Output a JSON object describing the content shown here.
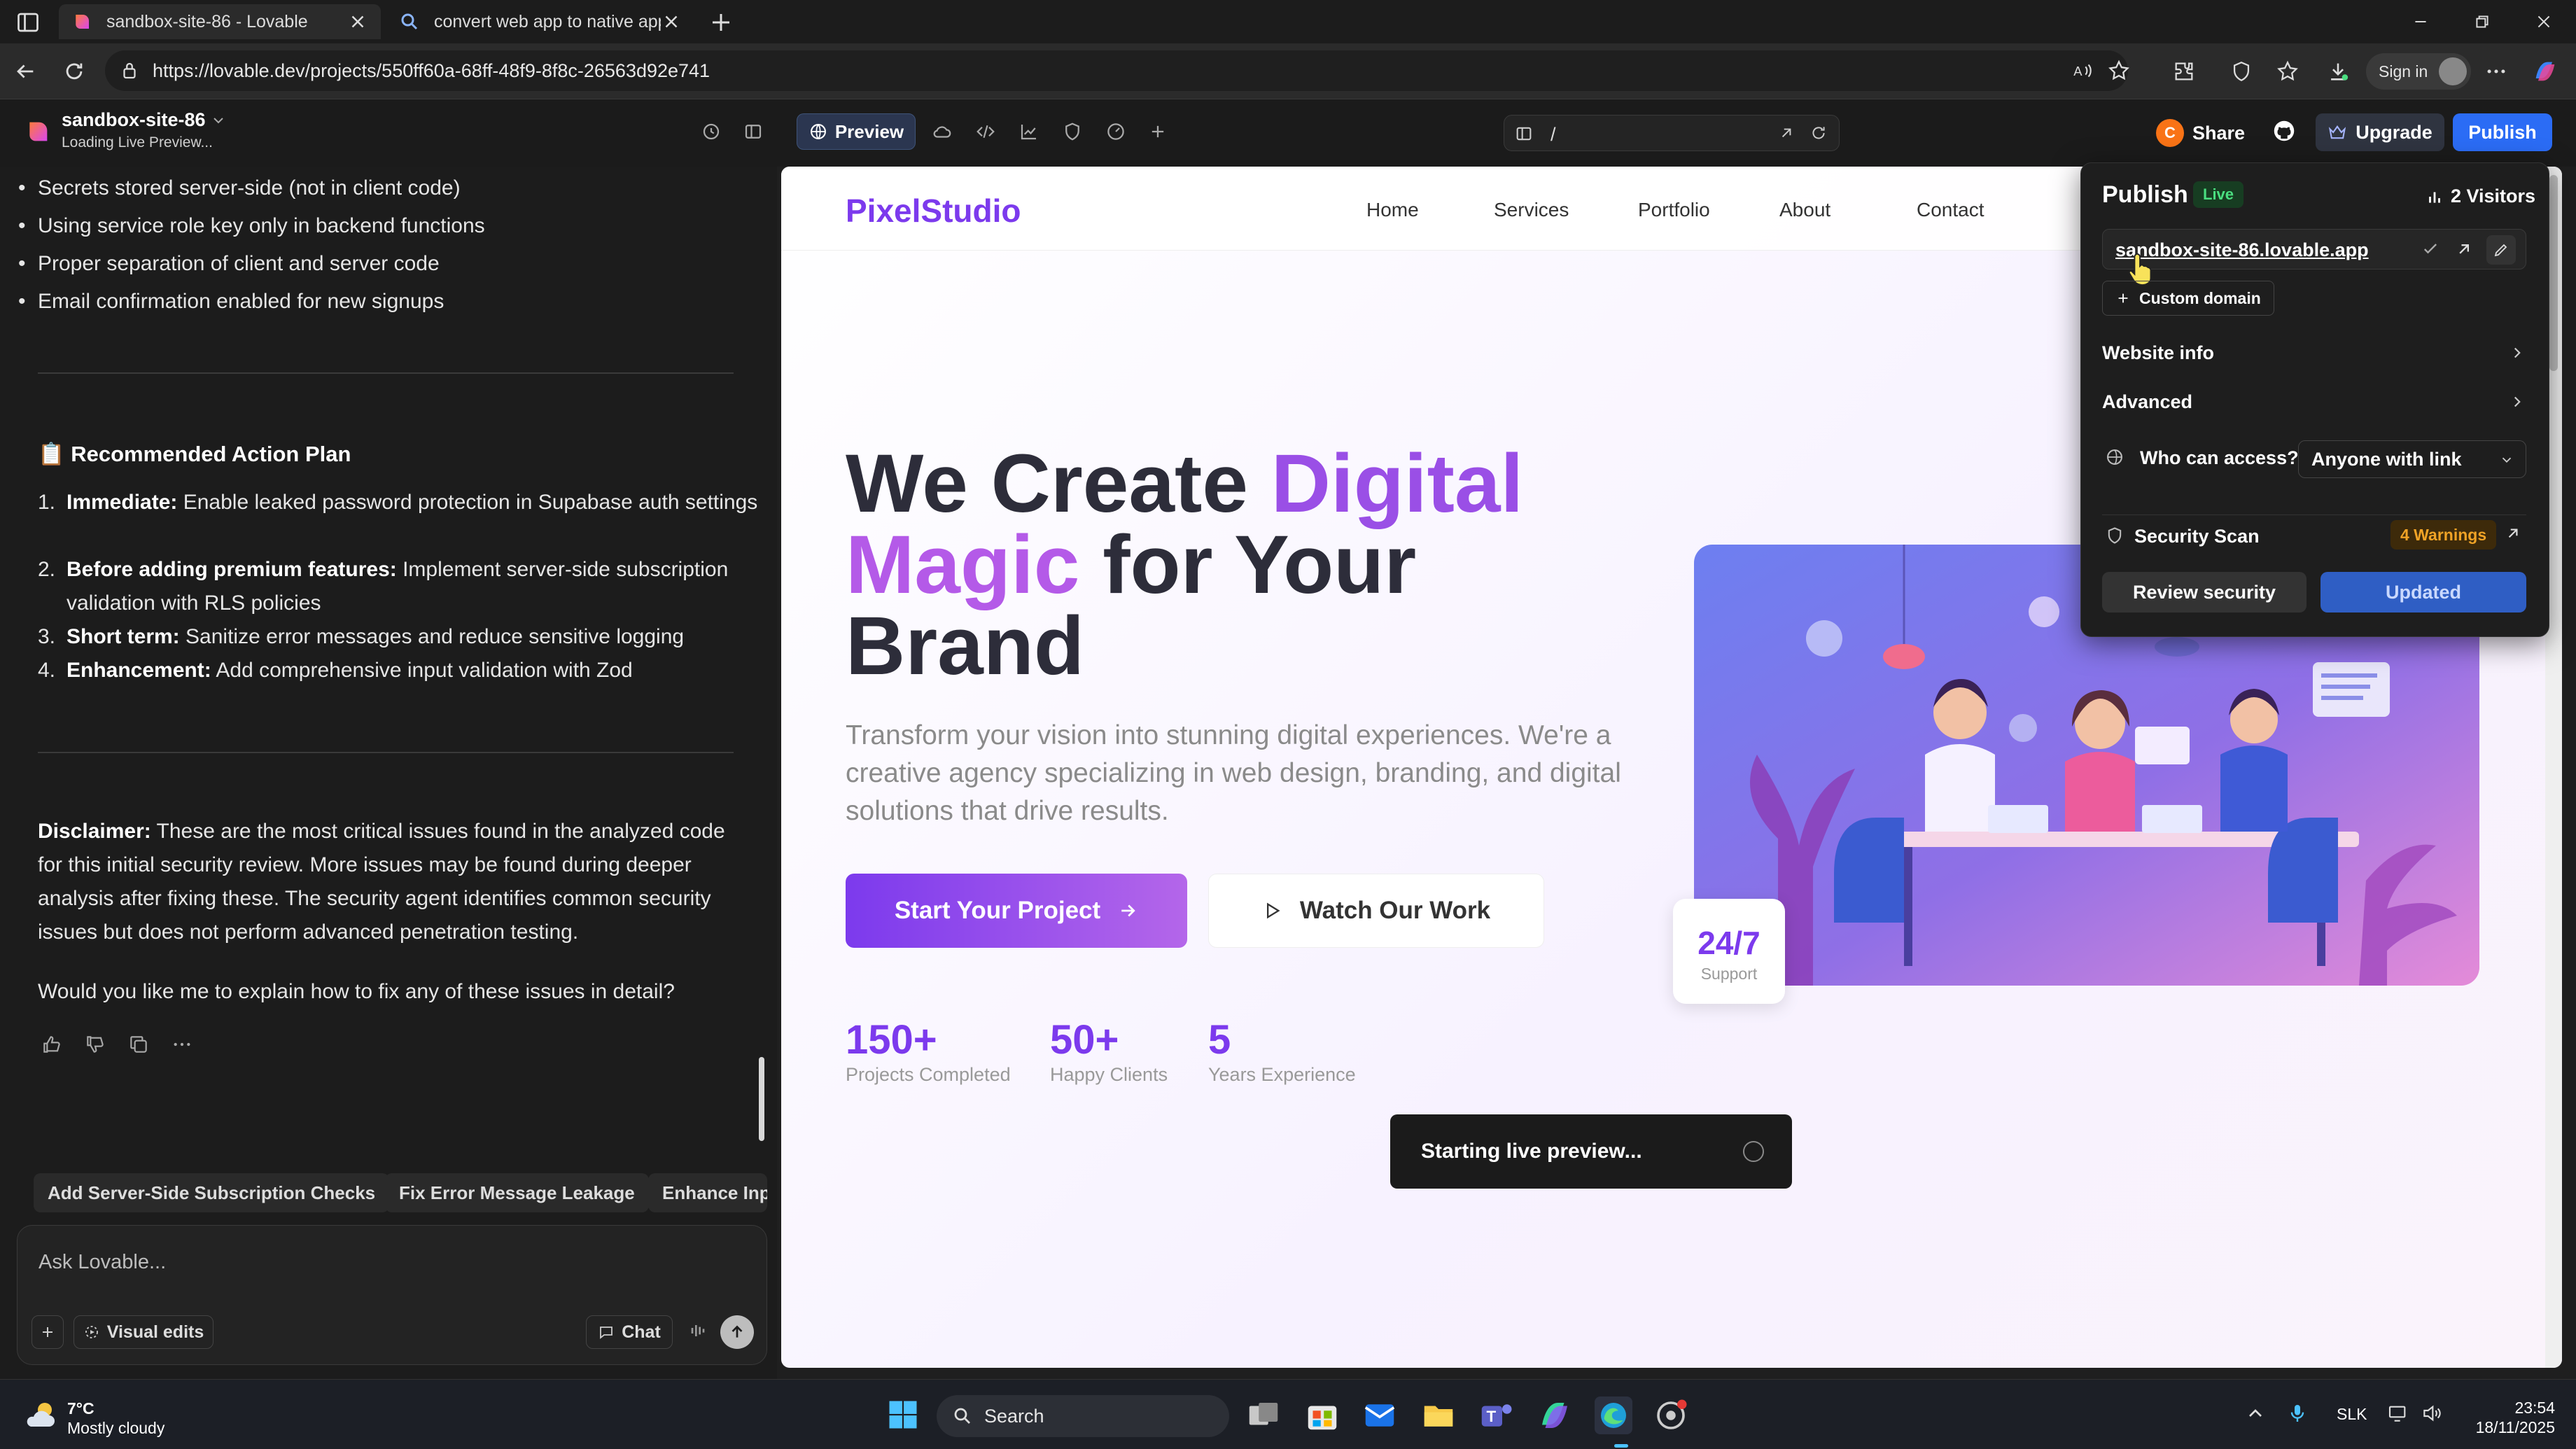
{
  "browser": {
    "tabs": [
      {
        "title": "sandbox-site-86 - Lovable",
        "active": true
      },
      {
        "title": "convert web app to native app - I",
        "active": false
      }
    ],
    "url": "https://lovable.dev/projects/550ff60a-68ff-48f9-8f8c-26563d92e741",
    "signin_label": "Sign in"
  },
  "header": {
    "project_name": "sandbox-site-86",
    "status": "Loading Live Preview...",
    "preview_label": "Preview",
    "path": "/",
    "share_label": "Share",
    "upgrade_label": "Upgrade",
    "publish_label": "Publish",
    "avatar_initial": "C"
  },
  "chat": {
    "bullets": [
      "Secrets stored server-side (not in client code)",
      "Using service role key only in backend functions",
      "Proper separation of client and server code",
      "Email confirmation enabled for new signups"
    ],
    "plan_title": "📋 Recommended Action Plan",
    "plan": [
      {
        "num": "1.",
        "label": "Immediate:",
        "text": " Enable leaked password protection in Supabase auth settings"
      },
      {
        "num": "2.",
        "label": "Before adding premium features:",
        "text": " Implement server-side subscription validation with RLS policies"
      },
      {
        "num": "3.",
        "label": "Short term:",
        "text": " Sanitize error messages and reduce sensitive logging"
      },
      {
        "num": "4.",
        "label": "Enhancement:",
        "text": " Add comprehensive input validation with Zod"
      }
    ],
    "disclaimer_label": "Disclaimer:",
    "disclaimer_text": " These are the most critical issues found in the analyzed code for this initial security review. More issues may be found during deeper analysis after fixing these. The security agent identifies common security issues but does not perform advanced penetration testing.",
    "followup": "Would you like me to explain how to fix any of these issues in detail?",
    "chips": [
      "Add Server-Side Subscription Checks",
      "Fix Error Message Leakage",
      "Enhance Inp"
    ],
    "input_placeholder": "Ask Lovable...",
    "visual_edits_label": "Visual edits",
    "chat_label": "Chat"
  },
  "site": {
    "brand": "PixelStudio",
    "nav": [
      "Home",
      "Services",
      "Portfolio",
      "About",
      "Contact"
    ],
    "hero_line1_a": "We Create ",
    "hero_line1_b": "Digital",
    "hero_line2_a": "Magic",
    "hero_line2_b": " for Your",
    "hero_line3": "Brand",
    "subtitle": "Transform your vision into stunning digital experiences. We're a creative agency specializing in web design, branding, and digital solutions that drive results.",
    "cta_primary": "Start Your Project",
    "cta_secondary": "Watch Our Work",
    "stats": [
      {
        "value": "150+",
        "label": "Projects Completed"
      },
      {
        "value": "50+",
        "label": "Happy Clients"
      },
      {
        "value": "5",
        "label": "Years Experience"
      }
    ],
    "badge_value": "24/7",
    "badge_label": "Support",
    "toast": "Starting live preview..."
  },
  "publish_panel": {
    "title": "Publish",
    "live_badge": "Live",
    "visitors": "2 Visitors",
    "domain": "sandbox-site-86.lovable.app",
    "custom_domain": "Custom domain",
    "website_info": "Website info",
    "advanced": "Advanced",
    "access_label": "Who can access?",
    "access_value": "Anyone with link",
    "security_scan": "Security Scan",
    "warnings": "4 Warnings",
    "review_label": "Review security",
    "updated_label": "Updated"
  },
  "taskbar": {
    "temp": "7°C",
    "weather": "Mostly cloudy",
    "search_label": "Search",
    "lang": "SLK",
    "time": "23:54",
    "date": "18/11/2025"
  },
  "colors": {
    "accent_purple": "#7c3aed",
    "publish_blue": "#2b6cf5",
    "live_green": "#4ade80",
    "warning_orange": "#f0a326"
  }
}
